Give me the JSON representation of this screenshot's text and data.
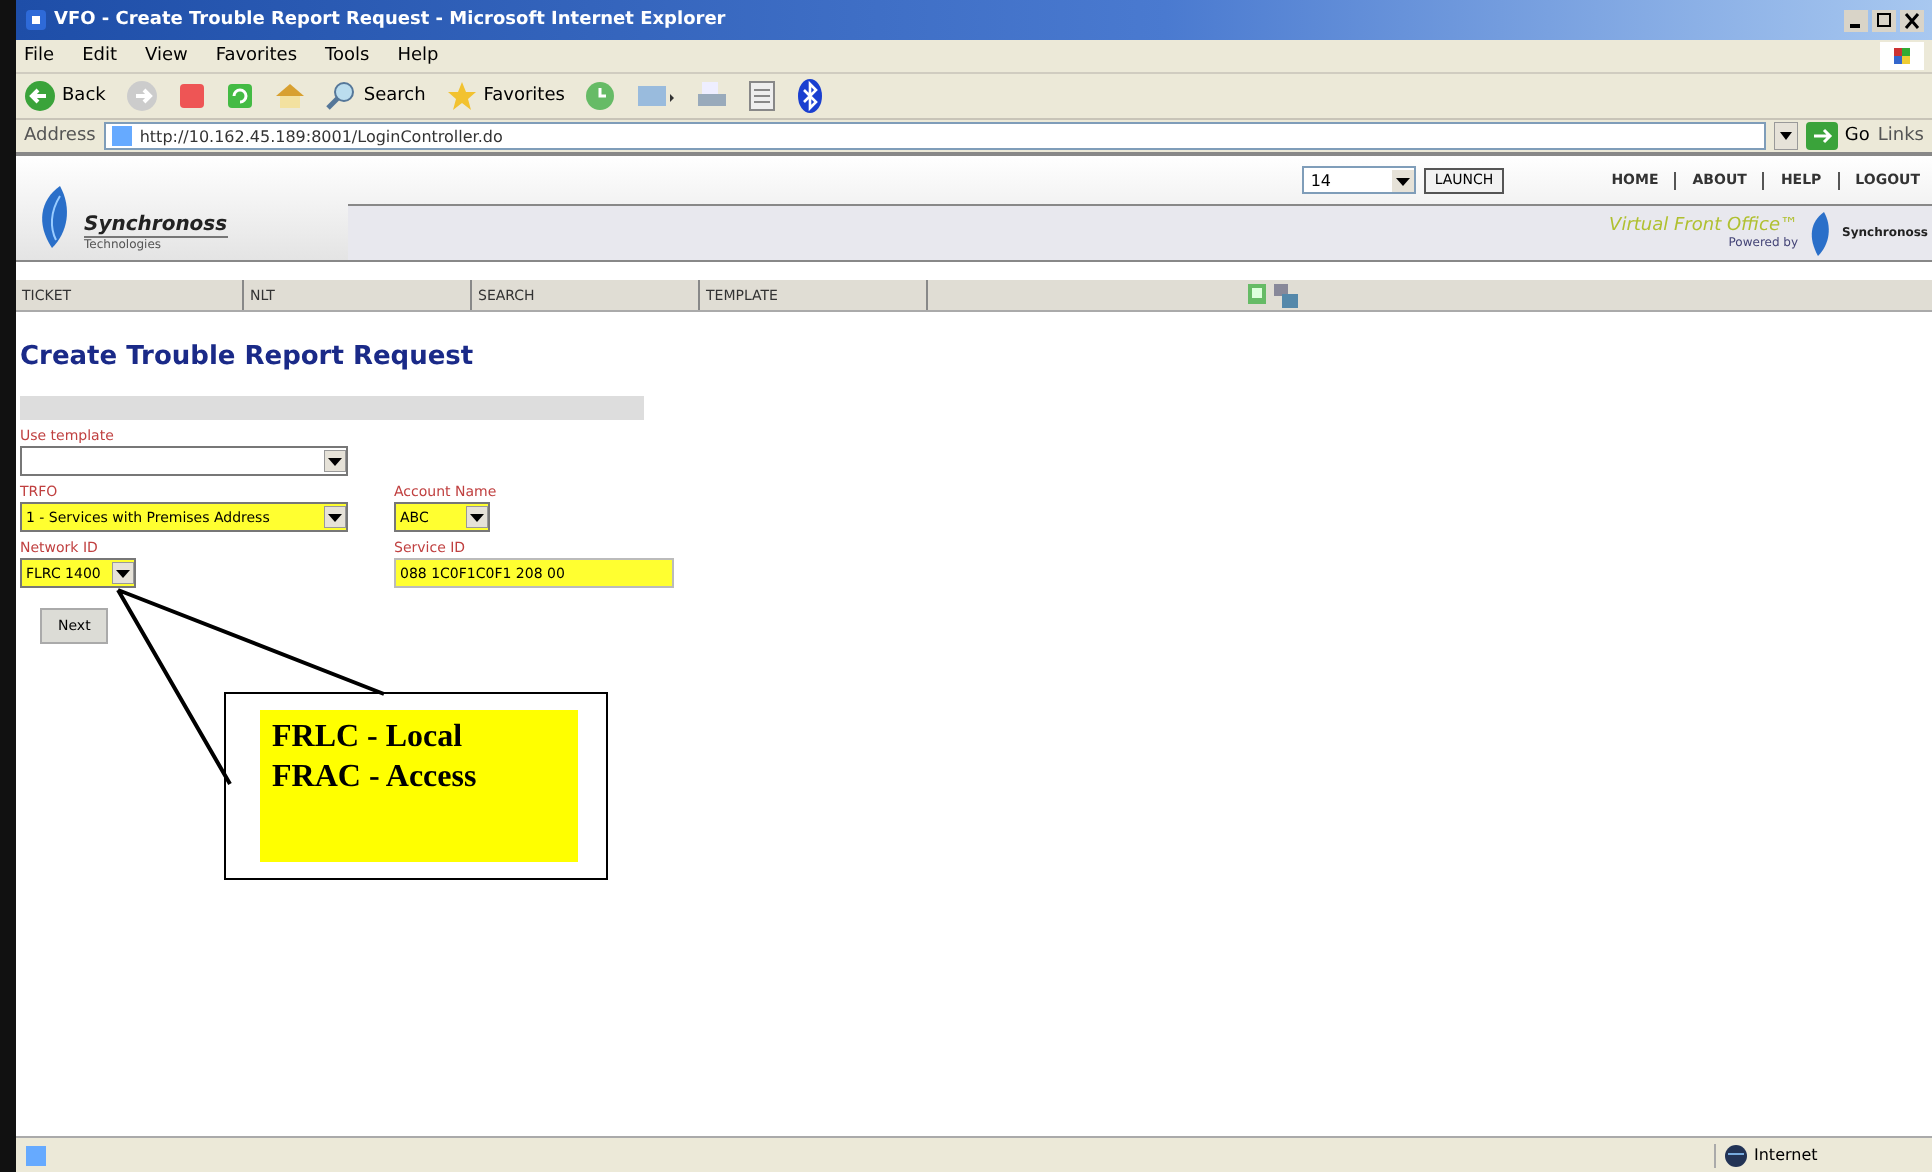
{
  "window": {
    "title": "VFO - Create Trouble Report Request - Microsoft Internet Explorer"
  },
  "menu": [
    "File",
    "Edit",
    "View",
    "Favorites",
    "Tools",
    "Help"
  ],
  "toolbar": [
    {
      "label": "Back"
    },
    {
      "label": "Search"
    },
    {
      "label": "Favorites"
    }
  ],
  "address": {
    "label": "Address",
    "value": "http://10.162.45.189:8001/LoginController.do",
    "go": "Go",
    "links": "Links"
  },
  "header": {
    "brand": "Synchronoss",
    "brand_sub": "Technologies",
    "select_value": "14",
    "launch": "LAUNCH",
    "nav": [
      "HOME",
      "ABOUT",
      "HELP",
      "LOGOUT"
    ],
    "product": "Virtual Front Office™",
    "powered_by": "Powered by",
    "partner": "Synchronoss"
  },
  "tabs": [
    {
      "label": "TICKET",
      "selected": false
    },
    {
      "label": "NLT",
      "selected": false
    },
    {
      "label": "SEARCH",
      "selected": false
    },
    {
      "label": "TEMPLATE",
      "selected": false
    }
  ],
  "form": {
    "heading": "Create Trouble Report Request",
    "rows": [
      [
        {
          "kind": "select",
          "label": "Use template",
          "highlighted": false
        }
      ],
      [
        {
          "kind": "select",
          "label": "TRFO",
          "value": "1 - Services with Premises Address",
          "highlighted": true
        },
        {
          "kind": "select",
          "label": "Account Name",
          "value": "ABC",
          "highlighted": true
        }
      ],
      [
        {
          "kind": "select",
          "label": "Network ID",
          "value": "FLRC 1400",
          "highlighted": true
        },
        {
          "kind": "text",
          "label": "Service ID",
          "value": "088 1C0F1C0F1 208 00",
          "highlighted": true
        }
      ]
    ],
    "button": "Next"
  },
  "callout": {
    "lines": [
      "FRLC - Local",
      "FRAC - Access"
    ]
  },
  "status_bar": {
    "zone": "Internet"
  }
}
